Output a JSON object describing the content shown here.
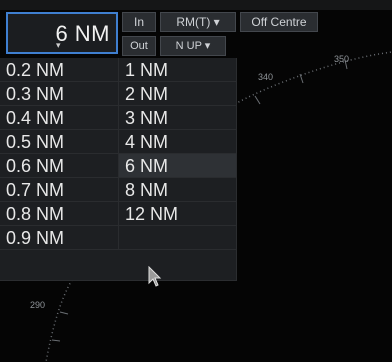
{
  "range_selector": {
    "value": "6 NM",
    "caret": "▾"
  },
  "buttons": {
    "in": "In",
    "rm": "RM(T) ▾",
    "off_centre": "Off Centre",
    "out": "Out",
    "nup": "N UP ▾"
  },
  "range_list": {
    "left": [
      "0.2 NM",
      "0.3 NM",
      "0.4 NM",
      "0.5 NM",
      "0.6 NM",
      "0.7 NM",
      "0.8 NM",
      "0.9 NM"
    ],
    "right": [
      "1 NM",
      "2 NM",
      "3 NM",
      "4 NM",
      "6 NM",
      "8 NM",
      "12 NM"
    ]
  },
  "bearing_labels": {
    "b340": "340",
    "b350": "350",
    "b290": "290"
  },
  "colors": {
    "accent": "#3f7fd0",
    "panel": "#1d1f22",
    "radar": "#050505"
  }
}
